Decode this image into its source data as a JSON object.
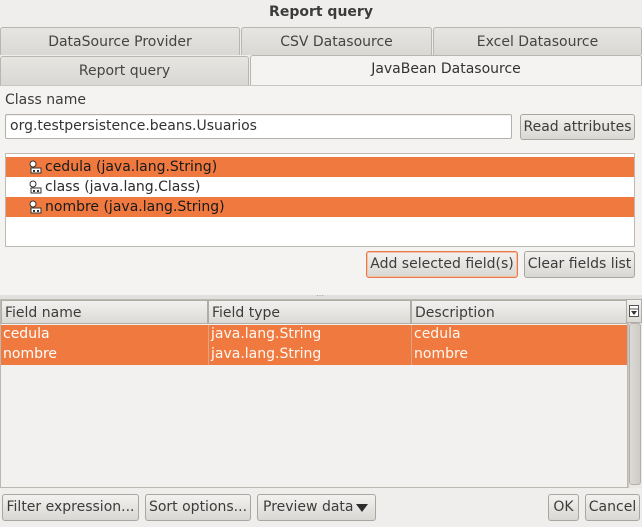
{
  "window": {
    "title": "Report query"
  },
  "tabs": {
    "row1": [
      "DataSource Provider",
      "CSV Datasource",
      "Excel Datasource"
    ],
    "row2": [
      "Report query",
      "JavaBean Datasource"
    ]
  },
  "javabean": {
    "class_label": "Class name",
    "class_value": "org.testpersistence.beans.Usuarios",
    "read_button": "Read attributes",
    "attributes": [
      {
        "label": "cedula (java.lang.String)",
        "selected": true
      },
      {
        "label": "class (java.lang.Class)",
        "selected": false
      },
      {
        "label": "nombre (java.lang.String)",
        "selected": true
      }
    ],
    "add_button": "Add selected field(s)",
    "clear_button": "Clear fields list"
  },
  "fields_table": {
    "headers": [
      "Field name",
      "Field type",
      "Description"
    ],
    "rows": [
      [
        "cedula",
        "java.lang.String",
        "cedula"
      ],
      [
        "nombre",
        "java.lang.String",
        "nombre"
      ]
    ]
  },
  "bottom": {
    "filter_button": "Filter expression...",
    "sort_button": "Sort options...",
    "preview_button": "Preview data",
    "ok_button": "OK",
    "cancel_button": "Cancel"
  },
  "colors": {
    "selection": "#f0793f",
    "focus_border": "#e77a4a"
  },
  "icons": {
    "attribute": "field-icon",
    "preview_dropdown": "triangle-down-icon",
    "column_control": "column-chooser-icon"
  }
}
